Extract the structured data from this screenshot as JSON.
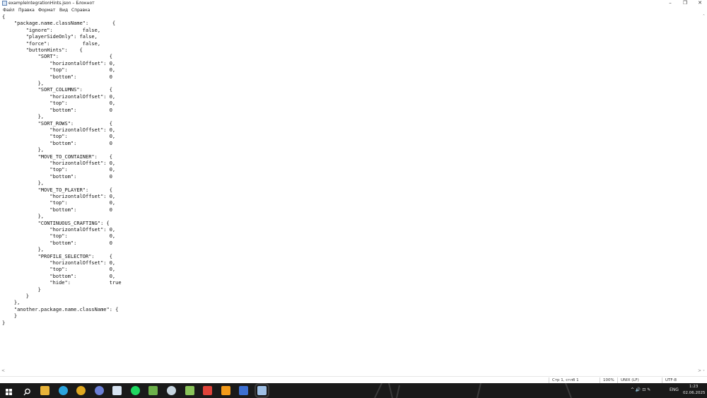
{
  "window": {
    "title": "exampleIntegrationHints.json – Блокнот",
    "minimize_glyph": "–",
    "maximize_glyph": "❐",
    "close_glyph": "✕"
  },
  "menu": {
    "items": [
      "Файл",
      "Правка",
      "Формат",
      "Вид",
      "Справка"
    ]
  },
  "editor": {
    "lines": [
      "{",
      "    \"package.name.className\":        {",
      "        \"ignore\":          false,",
      "        \"playerSideOnly\": false,",
      "        \"force\":           false,",
      "        \"buttonHints\":    {",
      "            \"SORT\":                 {",
      "                \"horizontalOffset\": 0,",
      "                \"top\":              0,",
      "                \"bottom\":           0",
      "            },",
      "            \"SORT_COLUMNS\":         {",
      "                \"horizontalOffset\": 0,",
      "                \"top\":              0,",
      "                \"bottom\":           0",
      "            },",
      "            \"SORT_ROWS\":            {",
      "                \"horizontalOffset\": 0,",
      "                \"top\":              0,",
      "                \"bottom\":           0",
      "            },",
      "            \"MOVE_TO_CONTAINER\":    {",
      "                \"horizontalOffset\": 0,",
      "                \"top\":              0,",
      "                \"bottom\":           0",
      "            },",
      "            \"MOVE_TO_PLAYER\":       {",
      "                \"horizontalOffset\": 0,",
      "                \"top\":              0,",
      "                \"bottom\":           0",
      "            },",
      "            \"CONTINUOUS_CRAFTING\": {",
      "                \"horizontalOffset\": 0,",
      "                \"top\":              0,",
      "                \"bottom\":           0",
      "            },",
      "            \"PROFILE_SELECTOR\":     {",
      "                \"horizontalOffset\": 0,",
      "                \"top\":              0,",
      "                \"bottom\":           0,",
      "                \"hide\":             true",
      "            }",
      "        }",
      "    },",
      "    \"another.package.name.className\": {",
      "    }",
      "}"
    ]
  },
  "scrollbars": {
    "up": "˄",
    "down": "˅",
    "left": "<",
    "right": ">"
  },
  "status": {
    "position": "Стр 1, стлб 1",
    "zoom": "100%",
    "line_ending": "UNIX (LF)",
    "encoding": "UTF-8"
  },
  "taskbar": {
    "apps": [
      {
        "name": "start-icon",
        "color": "#ffffff"
      },
      {
        "name": "search-icon",
        "color": "#ffffff"
      },
      {
        "name": "file-explorer-icon",
        "color": "#e8b339"
      },
      {
        "name": "telegram-icon",
        "color": "#2aa3dd"
      },
      {
        "name": "chrome-icon",
        "color": "#e0a820"
      },
      {
        "name": "app-icon-a",
        "color": "#6b7fd6"
      },
      {
        "name": "notes-icon",
        "color": "#d8e4f2"
      },
      {
        "name": "spotify-icon",
        "color": "#1ed760"
      },
      {
        "name": "minecraft-icon",
        "color": "#6cb04a"
      },
      {
        "name": "steam-icon",
        "color": "#c7d5e0"
      },
      {
        "name": "minecraft-launcher-icon",
        "color": "#8ac45a"
      },
      {
        "name": "app-icon-b",
        "color": "#e0433a"
      },
      {
        "name": "app-icon-c",
        "color": "#f29a1a"
      },
      {
        "name": "app-icon-d",
        "color": "#3c6fd1"
      },
      {
        "name": "notepad-icon",
        "color": "#9fc0e6"
      }
    ],
    "tray": {
      "icons_text": "^ 🔊 ⊡ ✎",
      "language": "ENG",
      "time": "1:23",
      "date": "02.06.2025"
    }
  }
}
